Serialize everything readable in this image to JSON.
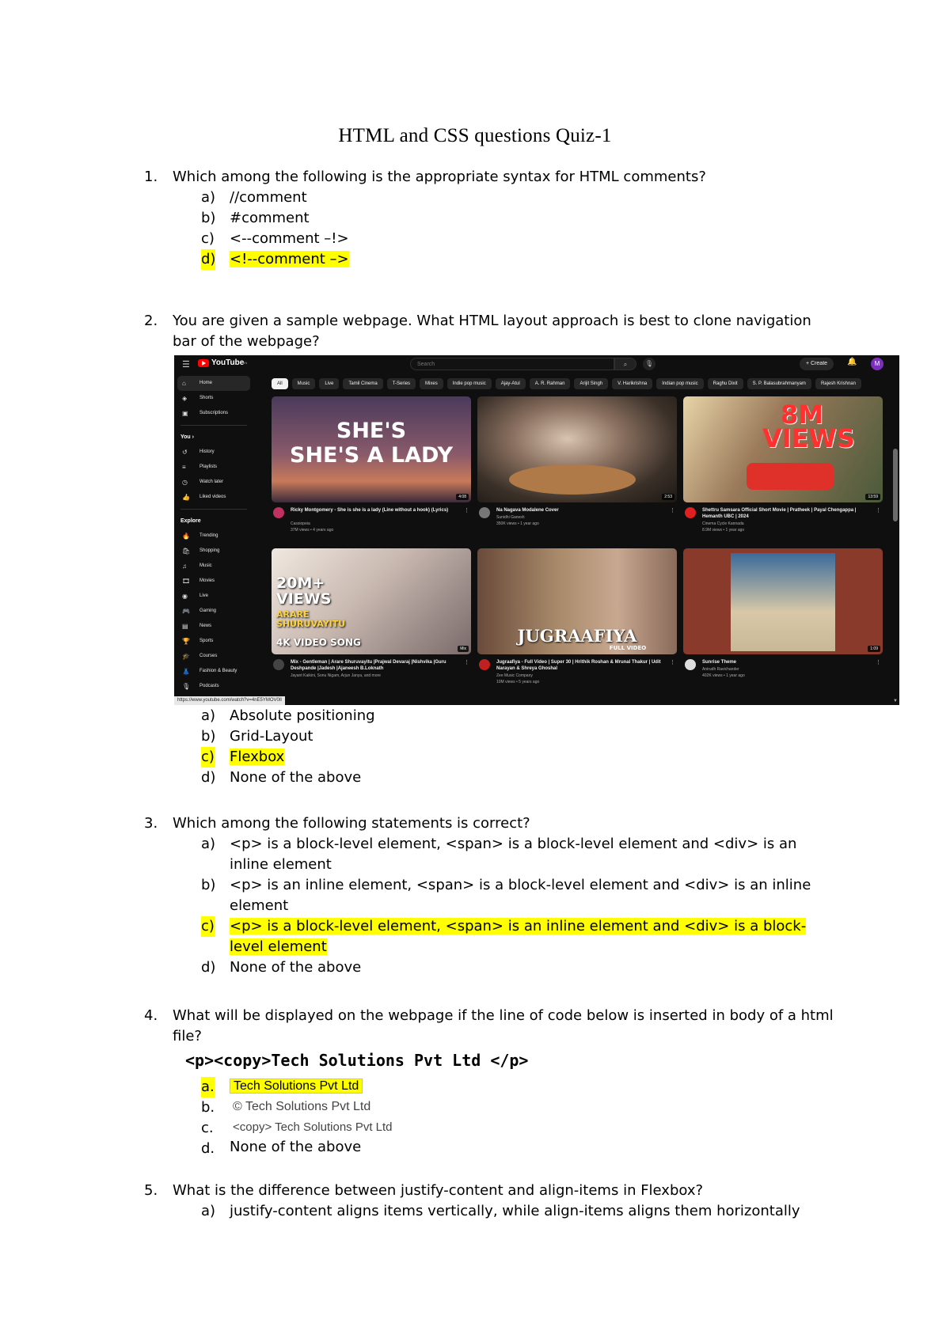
{
  "title": "HTML and CSS questions Quiz-1",
  "questions": [
    {
      "num": "1.",
      "text": "Which among the following is the appropriate syntax for HTML comments?",
      "options": [
        {
          "label": "a)",
          "text": "//comment"
        },
        {
          "label": "b)",
          "text": "#comment"
        },
        {
          "label": "c)",
          "text": "<--comment –!>"
        },
        {
          "label": "d)",
          "text": "<!--comment –>"
        }
      ]
    },
    {
      "num": "2.",
      "text": "You are given a sample webpage. What HTML layout approach is best to clone navigation bar of the webpage?",
      "options": [
        {
          "label": "a)",
          "text": "Absolute positioning"
        },
        {
          "label": "b)",
          "text": "Grid-Layout"
        },
        {
          "label": "c)",
          "text": "Flexbox"
        },
        {
          "label": "d)",
          "text": "None of the above"
        }
      ]
    },
    {
      "num": "3.",
      "text": "Which among the following statements is correct?",
      "options": [
        {
          "label": "a)",
          "text": "<p> is a block-level element, <span> is a block-level element and <div> is an inline element"
        },
        {
          "label": "b)",
          "text": "<p> is an inline element, <span> is a block-level element and <div> is an inline element"
        },
        {
          "label": "c)",
          "text": "<p> is a block-level element, <span> is an inline element and <div> is a block-level element"
        },
        {
          "label": "d)",
          "text": "None of the above"
        }
      ]
    },
    {
      "num": "4.",
      "text": "What will be displayed on the webpage if the line of code below is inserted in body of a html file?",
      "code": "<p><copy>Tech Solutions Pvt Ltd </p>",
      "options": [
        {
          "label": "a.",
          "text": "Tech Solutions Pvt Ltd"
        },
        {
          "label": "b.",
          "text": "© Tech Solutions Pvt Ltd"
        },
        {
          "label": "c.",
          "text": "<copy> Tech Solutions Pvt Ltd"
        },
        {
          "label": "d.",
          "text": "None of the above"
        }
      ]
    },
    {
      "num": "5.",
      "text": "What is the difference between justify-content and align-items in Flexbox?",
      "options": [
        {
          "label": "a)",
          "text": "justify-content aligns items vertically, while align-items aligns them horizontally"
        }
      ]
    }
  ],
  "highlight_color": "#ffff00",
  "screenshot": {
    "logo": "YouTube",
    "logo_sup": "IN",
    "search_placeholder": "Search",
    "create_label": "+ Create",
    "avatar_letter": "M",
    "sidebar": [
      {
        "icon": "home-icon",
        "label": "Home"
      },
      {
        "icon": "shorts-icon",
        "label": "Shorts"
      },
      {
        "icon": "subscriptions-icon",
        "label": "Subscriptions"
      }
    ],
    "you_heading": "You  ›",
    "you_items": [
      {
        "icon": "history-icon",
        "label": "History"
      },
      {
        "icon": "playlists-icon",
        "label": "Playlists"
      },
      {
        "icon": "watch-later-icon",
        "label": "Watch later"
      },
      {
        "icon": "liked-videos-icon",
        "label": "Liked videos"
      }
    ],
    "explore_heading": "Explore",
    "explore_items": [
      {
        "icon": "trending-icon",
        "label": "Trending"
      },
      {
        "icon": "shopping-icon",
        "label": "Shopping"
      },
      {
        "icon": "music-icon",
        "label": "Music"
      },
      {
        "icon": "movies-icon",
        "label": "Movies"
      },
      {
        "icon": "live-icon",
        "label": "Live"
      },
      {
        "icon": "gaming-icon",
        "label": "Gaming"
      },
      {
        "icon": "news-icon",
        "label": "News"
      },
      {
        "icon": "sports-icon",
        "label": "Sports"
      },
      {
        "icon": "courses-icon",
        "label": "Courses"
      },
      {
        "icon": "fashion-icon",
        "label": "Fashion & Beauty"
      },
      {
        "icon": "podcasts-icon",
        "label": "Podcasts"
      }
    ],
    "chips": [
      "All",
      "Music",
      "Live",
      "Tamil Cinema",
      "T-Series",
      "Mixes",
      "Indie pop music",
      "Ajay-Atul",
      "A. R. Rahman",
      "Arijit Singh",
      "V. Harikrishna",
      "Indian pop music",
      "Raghu Dixit",
      "S. P. Balasubrahmanyam",
      "Rajesh Krishnan"
    ],
    "videos": [
      {
        "title": "Ricky Montgomery - She is she is a lady (Line without a hook) (Lyrics)",
        "channel": "Cassiopeia",
        "stats": "37M views • 4 years ago",
        "duration": "4:08",
        "overlay": "SHE'S\nSHE'S A LADY"
      },
      {
        "title": "Na Nagava Modalene Cover",
        "channel": "Sunidhi Ganesh",
        "stats": "350K views • 1 year ago",
        "duration": "2:53",
        "overlay": ""
      },
      {
        "title": "Shettru Samsara Official Short Movie | Pratheek | Payal Chengappa | Hemanth UBC | 2024",
        "channel": "Cinema Cycle Kannada",
        "stats": "8.9M views • 1 year ago",
        "duration": "13:59",
        "overlay": "8M\nVIEWS"
      },
      {
        "title": "Mix - Gentleman | Arare Shuruvayitu |Prajwal Devaraj |Nishvika |Guru Deshpande |Jadesh |Ajaneesh B.Loknath",
        "channel": "Jayant Kaikini, Sonu Nigam, Arjun Janya, and more",
        "stats": "",
        "duration": "Mix",
        "overlay": "20M+\nVIEWS"
      },
      {
        "title": "Jugraafiya - Full Video | Super 30 | Hrithik Roshan & Mrunal Thakur | Udit Narayan & Shreya Ghoshal",
        "channel": "Zee Music Company",
        "stats": "10M views • 5 years ago",
        "duration": "",
        "overlay": "JUGRAAFIYA"
      },
      {
        "title": "Sunrise Theme",
        "channel": "Anirudh Ravichander",
        "stats": "402K views • 1 year ago",
        "duration": "1:09",
        "overlay": ""
      }
    ],
    "thumb_extra": {
      "v4_sub": "ARARE\nSHURUVAYITU",
      "v4_bottom": "4K VIDEO SONG",
      "v5_bottom": "FULL VIDEO"
    },
    "status_url": "https://www.youtube.com/watch?v=4nE5YMOV0lI"
  }
}
